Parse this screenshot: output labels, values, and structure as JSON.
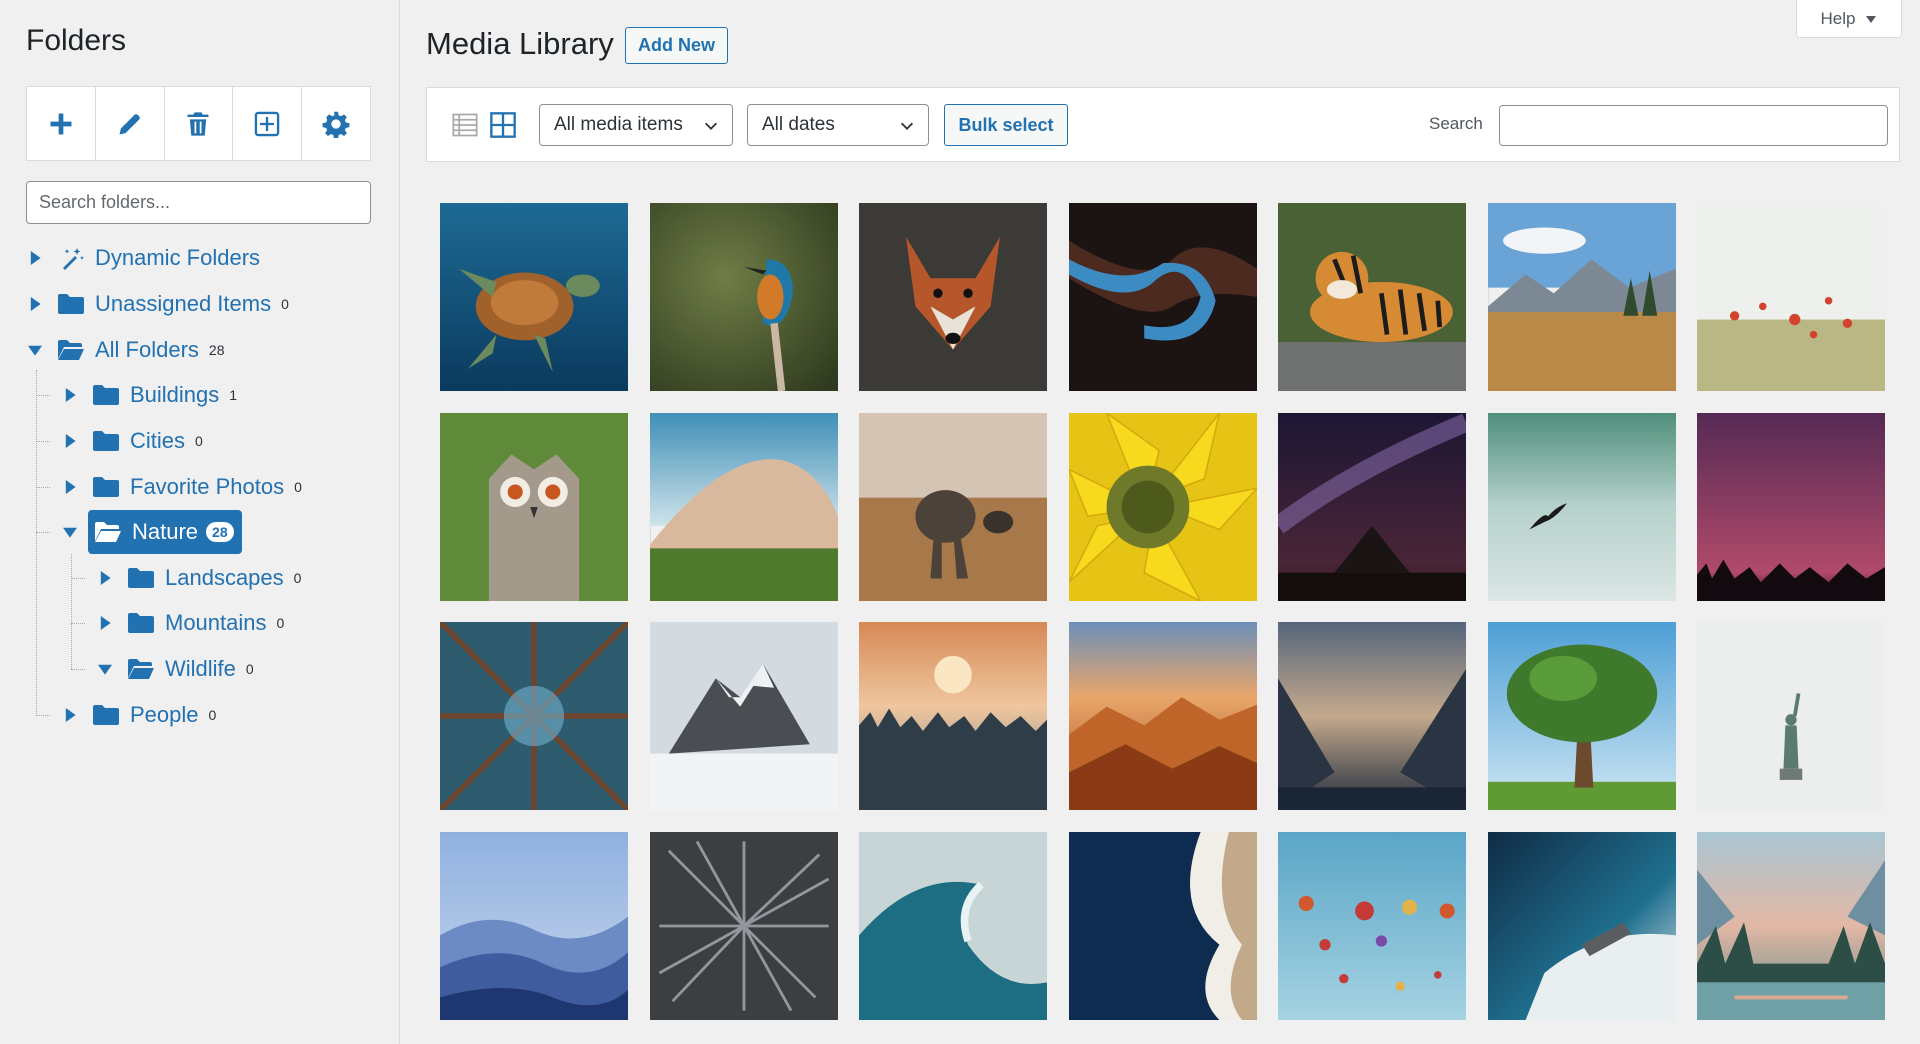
{
  "sidebar": {
    "title": "Folders",
    "toolbar": [
      "plus-icon",
      "pencil-icon",
      "trash-icon",
      "plus-square-icon",
      "gear-icon"
    ],
    "search_placeholder": "Search folders...",
    "tree": {
      "dynamic": {
        "label": "Dynamic Folders"
      },
      "unassigned": {
        "label": "Unassigned Items",
        "count": "0"
      },
      "all": {
        "label": "All Folders",
        "count": "28"
      },
      "buildings": {
        "label": "Buildings",
        "count": "1"
      },
      "cities": {
        "label": "Cities",
        "count": "0"
      },
      "favorite": {
        "label": "Favorite Photos",
        "count": "0"
      },
      "nature": {
        "label": "Nature",
        "count": "28"
      },
      "landscapes": {
        "label": "Landscapes",
        "count": "0"
      },
      "mountains": {
        "label": "Mountains",
        "count": "0"
      },
      "wildlife": {
        "label": "Wildlife",
        "count": "0"
      },
      "people": {
        "label": "People",
        "count": "0"
      }
    }
  },
  "main": {
    "title": "Media Library",
    "add_new": "Add New",
    "help": "Help",
    "filters": {
      "media_type": "All media items",
      "dates": "All dates",
      "bulk_select": "Bulk select",
      "search_label": "Search",
      "search_value": ""
    },
    "accent_color": "#2271b1",
    "thumbnails": [
      "sea-turtle",
      "kingfisher",
      "red-fox",
      "dark-canyon",
      "tiger",
      "mountain-meadow",
      "poppy-field",
      "owl",
      "sand-dune",
      "elephant",
      "sunflower",
      "milky-way-night",
      "waterfall-bird",
      "purple-dusk",
      "forest-canopy",
      "snowy-peak",
      "winter-forest-sunrise",
      "orange-mountains",
      "misty-valley",
      "oak-tree",
      "statue-of-liberty",
      "blue-hills",
      "aerial-texture",
      "ocean-wave",
      "aerial-beach",
      "hot-air-balloons",
      "shipwreck",
      "yosemite-river"
    ]
  }
}
